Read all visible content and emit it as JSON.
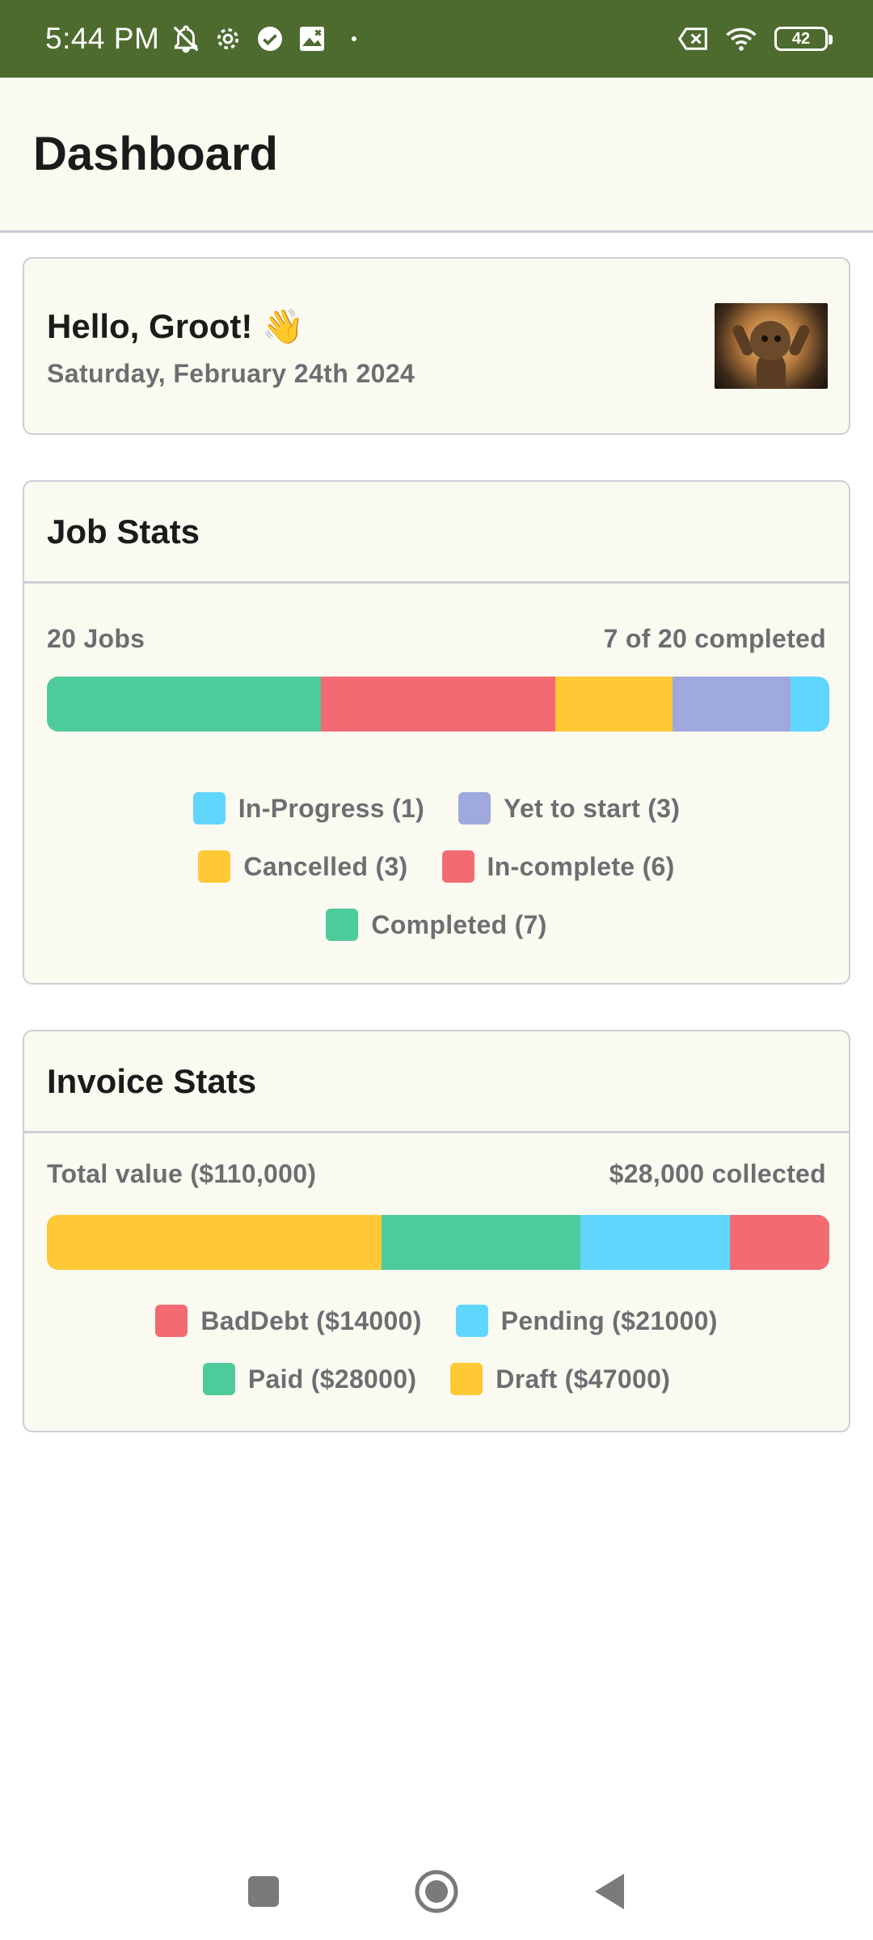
{
  "status_bar": {
    "time": "5:44 PM",
    "battery": "42",
    "icons": [
      "notifications-off-icon",
      "gear-icon",
      "check-circle-icon",
      "image-icon",
      "dot-icon",
      "no-sim-icon",
      "wifi-icon",
      "battery-icon"
    ]
  },
  "app_bar": {
    "title": "Dashboard"
  },
  "greeting": {
    "title": "Hello, Groot! 👋",
    "date": "Saturday, February 24th 2024",
    "avatar": "groot-avatar"
  },
  "job_stats": {
    "title": "Job Stats",
    "total_label": "20 Jobs",
    "completed_label": "7 of 20 completed",
    "bar": [
      {
        "name": "Completed",
        "value": 7,
        "color": "#4ecb9c"
      },
      {
        "name": "In-complete",
        "value": 6,
        "color": "#f26b72"
      },
      {
        "name": "Cancelled",
        "value": 3,
        "color": "#fec935"
      },
      {
        "name": "Yet to start",
        "value": 3,
        "color": "#9fa9dd"
      },
      {
        "name": "In-Progress",
        "value": 1,
        "color": "#61d6fd"
      }
    ],
    "legend_rows": [
      [
        {
          "label": "In-Progress (1)",
          "color": "#61d6fd"
        },
        {
          "label": "Yet to start (3)",
          "color": "#9fa9dd"
        }
      ],
      [
        {
          "label": "Cancelled (3)",
          "color": "#fec935"
        },
        {
          "label": "In-complete (6)",
          "color": "#f26b72"
        }
      ],
      [
        {
          "label": "Completed (7)",
          "color": "#4ecb9c"
        }
      ]
    ]
  },
  "invoice_stats": {
    "title": "Invoice Stats",
    "total_label": "Total value ($110,000)",
    "collected_label": "$28,000 collected",
    "bar": [
      {
        "name": "Draft",
        "value": 47000,
        "color": "#fec935"
      },
      {
        "name": "Paid",
        "value": 28000,
        "color": "#4ecb9c"
      },
      {
        "name": "Pending",
        "value": 21000,
        "color": "#61d6fd"
      },
      {
        "name": "BadDebt",
        "value": 14000,
        "color": "#f26b72"
      }
    ],
    "legend_rows": [
      [
        {
          "label": "BadDebt ($14000)",
          "color": "#f26b72"
        },
        {
          "label": "Pending ($21000)",
          "color": "#61d6fd"
        }
      ],
      [
        {
          "label": "Paid ($28000)",
          "color": "#4ecb9c"
        },
        {
          "label": "Draft ($47000)",
          "color": "#fec935"
        }
      ]
    ]
  },
  "nav_bar": {
    "buttons": [
      "recents-button",
      "home-button",
      "back-button"
    ]
  },
  "colors": {
    "status_bar": "#4e6b2f",
    "surface": "#fbfaf1",
    "outline": "#cfcdd5",
    "muted_text": "#6f6d72"
  }
}
